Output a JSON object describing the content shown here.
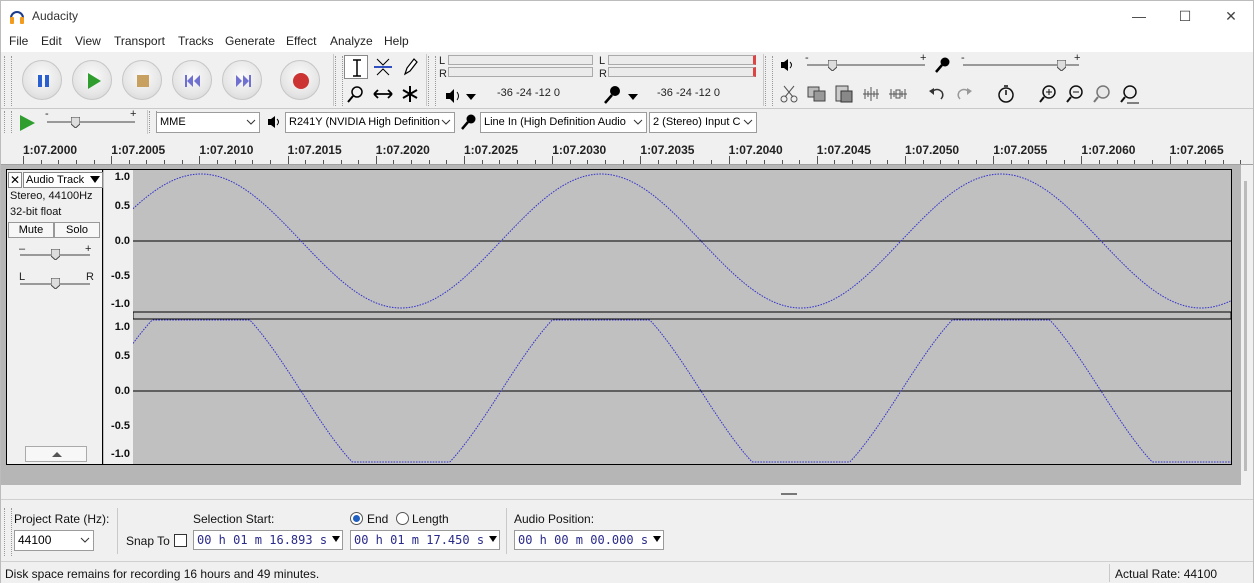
{
  "window": {
    "title": "Audacity",
    "minimize": "—",
    "maximize": "☐",
    "close": "✕"
  },
  "menu": [
    "File",
    "Edit",
    "View",
    "Transport",
    "Tracks",
    "Generate",
    "Effect",
    "Analyze",
    "Help"
  ],
  "meters": {
    "playback_lr": [
      "L",
      "R"
    ],
    "record_lr": [
      "L",
      "R"
    ],
    "playback_ticks": "-36   -24   -12    0",
    "record_ticks": "-36   -24   -12    0"
  },
  "device": {
    "host": "MME",
    "output": "R241Y (NVIDIA High Definition",
    "input": "Line In (High Definition Audio",
    "channels": "2 (Stereo) Input C"
  },
  "sliders": {
    "minus": "-",
    "plus": "+"
  },
  "ruler": [
    "1:07.2000",
    "1:07.2005",
    "1:07.2010",
    "1:07.2015",
    "1:07.2020",
    "1:07.2025",
    "1:07.2030",
    "1:07.2035",
    "1:07.2040",
    "1:07.2045",
    "1:07.2050",
    "1:07.2055",
    "1:07.2060",
    "1:07.2065"
  ],
  "track": {
    "close": "✕",
    "name": "Audio Track",
    "info1": "Stereo, 44100Hz",
    "info2": "32-bit float",
    "mute": "Mute",
    "solo": "Solo",
    "gain_minus": "–",
    "gain_plus": "+",
    "pan_left": "L",
    "pan_right": "R",
    "scale": [
      "1.0",
      "0.5",
      "0.0",
      "-0.5",
      "-1.0"
    ]
  },
  "selection": {
    "project_rate_label": "Project Rate (Hz):",
    "project_rate": "44100",
    "snap_to": "Snap To",
    "selection_start_label": "Selection Start:",
    "end_label": "End",
    "length_label": "Length",
    "audio_position_label": "Audio Position:",
    "start_time": "00 h 01 m 16.893 s",
    "end_time": "00 h 01 m 17.450 s",
    "audio_position": "00 h 00 m 00.000 s"
  },
  "status": {
    "disk": "Disk space remains for recording 16 hours and 49 minutes.",
    "rate": "Actual Rate: 44100"
  },
  "colors": {
    "waveform": "#3333cc",
    "track_bg": "#c0c0c0",
    "record": "#cc3333",
    "play": "#2f9e2f",
    "pause": "#2a5fd0"
  }
}
